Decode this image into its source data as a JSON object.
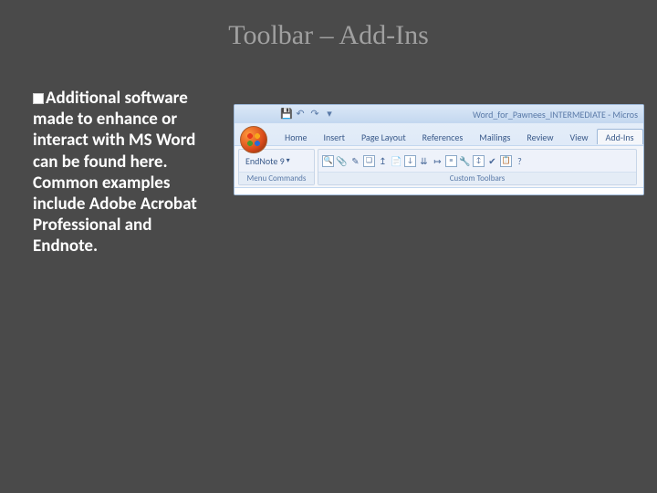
{
  "slide": {
    "title": "Toolbar – Add-Ins",
    "bullet_text": "Additional software made to enhance or interact with MS Word can be found here. Common examples include Adobe Acrobat Professional and Endnote."
  },
  "word_window": {
    "doc_title": "Word_for_Pawnees_INTERMEDIATE - Micros",
    "qat": {
      "save": "💾",
      "undo": "↶",
      "redo": "↷",
      "more": "▾"
    },
    "tabs": [
      "Home",
      "Insert",
      "Page Layout",
      "References",
      "Mailings",
      "Review",
      "View",
      "Add-Ins"
    ],
    "active_tab": "Add-Ins",
    "groups": {
      "menu": {
        "label": "Menu Commands",
        "endnote": "EndNote 9",
        "dropdown": "▾"
      },
      "custom": {
        "label": "Custom Toolbars"
      }
    }
  }
}
